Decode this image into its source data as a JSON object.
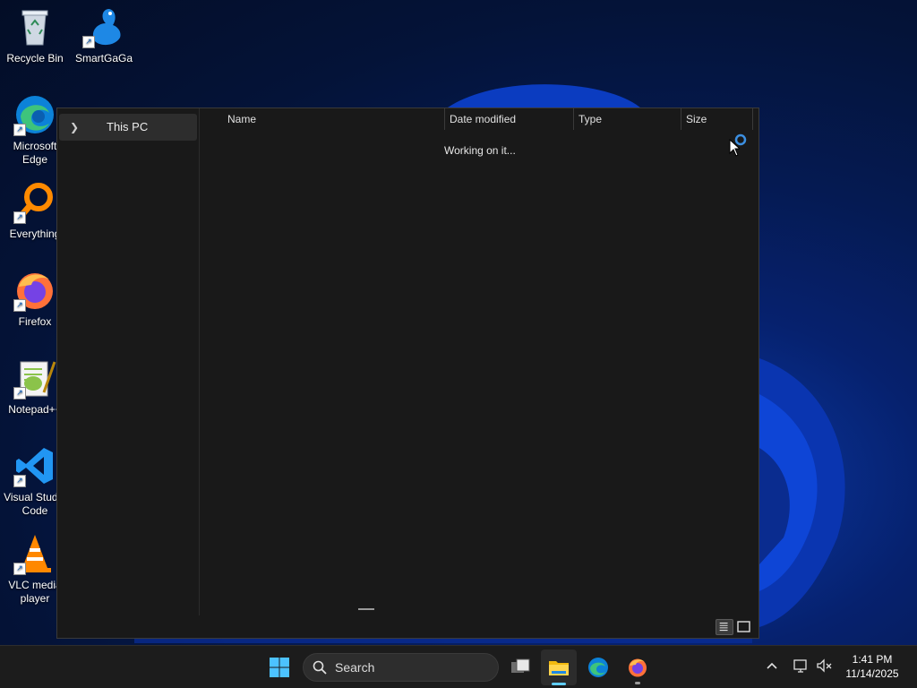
{
  "desktop": {
    "icons": [
      {
        "label": "Recycle Bin",
        "icon": "recycle-bin-icon"
      },
      {
        "label": "SmartGaGa",
        "icon": "smartgaga-icon"
      },
      {
        "label": "Microsoft Edge",
        "icon": "edge-icon"
      },
      {
        "label": "Everything",
        "icon": "everything-icon"
      },
      {
        "label": "Firefox",
        "icon": "firefox-icon"
      },
      {
        "label": "Notepad++",
        "icon": "notepadpp-icon"
      },
      {
        "label": "Visual Studio Code",
        "icon": "vscode-icon"
      },
      {
        "label": "VLC media player",
        "icon": "vlc-icon"
      }
    ]
  },
  "explorer": {
    "nav": {
      "this_pc": "This PC"
    },
    "columns": {
      "name": "Name",
      "date_modified": "Date modified",
      "type": "Type",
      "size": "Size"
    },
    "status": "Working on it..."
  },
  "taskbar": {
    "search_placeholder": "Search",
    "time": "1:41 PM",
    "date": "11/14/2025"
  },
  "colors": {
    "accent": "#60cdff",
    "window_bg": "#191919",
    "taskbar_bg": "#1c1c1c"
  }
}
